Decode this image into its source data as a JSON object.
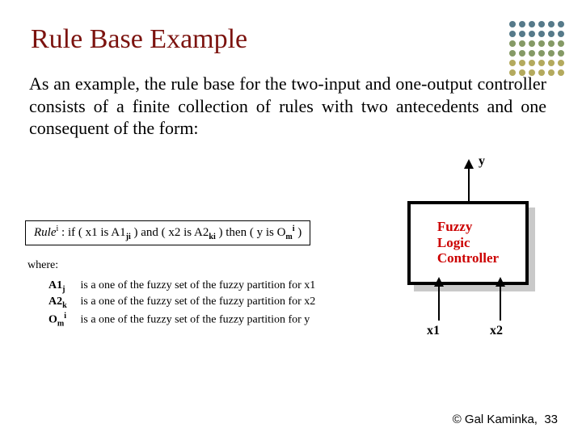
{
  "title": "Rule Base Example",
  "paragraph": "As an example, the rule base for the two-input and one-output controller consists of a finite collection of rules with two antecedents and one consequent of the form:",
  "rule": {
    "prefix": "Rule",
    "sup": "i",
    "body": " : if ( x1 is A1",
    "a1sub": "ji",
    "mid1": " ) and ( x2 is A2",
    "a2sub": "ki",
    "mid2": " ) then ( y is O",
    "osub": "m",
    "osup": "i",
    "end": " )"
  },
  "where": "where:",
  "defs": [
    {
      "sym": "A1",
      "sub": "j",
      "sup": "",
      "text": " is a one of the fuzzy set of the fuzzy partition for x1"
    },
    {
      "sym": "A2",
      "sub": "k",
      "sup": "",
      "text": " is a one of the fuzzy set of the fuzzy partition for x2"
    },
    {
      "sym": "O",
      "sub": "m",
      "sup": "i",
      "text": " is a one of the fuzzy set of the fuzzy partition for y"
    }
  ],
  "diagram": {
    "box_l1": "Fuzzy",
    "box_l2": "Logic",
    "box_l3": "Controller",
    "out": "y",
    "in1": "x1",
    "in2": "x2"
  },
  "footer": {
    "copyright": "© Gal Kaminka,",
    "page": "33"
  },
  "colors": {
    "title": "#7c130f",
    "fuzzy": "#cc0000"
  }
}
